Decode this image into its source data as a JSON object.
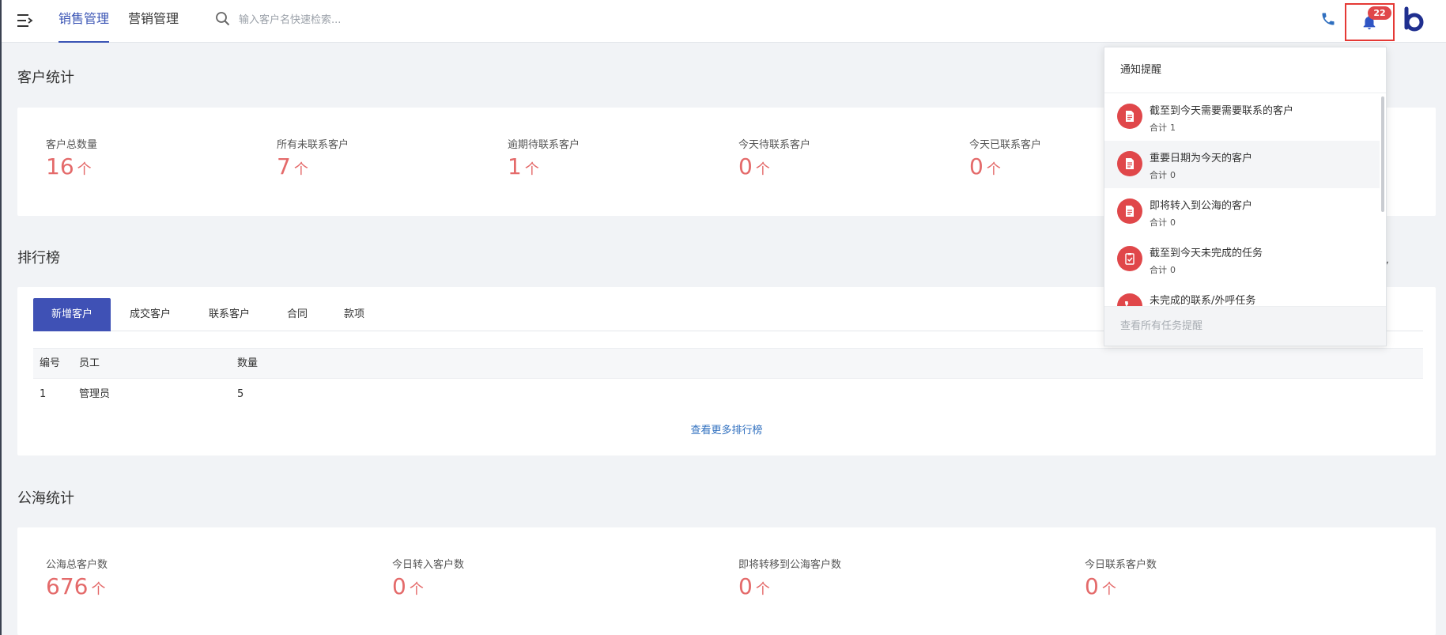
{
  "nav": {
    "tabs": [
      {
        "label": "销售管理",
        "active": true
      },
      {
        "label": "营销管理",
        "active": false
      }
    ],
    "search_placeholder": "输入客户名快速检索...",
    "notification_count": "22"
  },
  "customer_stats": {
    "title": "客户统计",
    "unit": "个",
    "items": [
      {
        "label": "客户总数量",
        "value": "16"
      },
      {
        "label": "所有未联系客户",
        "value": "7"
      },
      {
        "label": "逾期待联系客户",
        "value": "1"
      },
      {
        "label": "今天待联系客户",
        "value": "0"
      },
      {
        "label": "今天已联系客户",
        "value": "0"
      }
    ]
  },
  "ranking": {
    "title": "排行榜",
    "tabs": [
      "新增客户",
      "成交客户",
      "联系客户",
      "合同",
      "款项"
    ],
    "active_tab": 0,
    "columns": [
      "编号",
      "员工",
      "数量"
    ],
    "rows": [
      [
        "1",
        "管理员",
        "5"
      ]
    ],
    "more_link": "查看更多排行榜"
  },
  "sea_stats": {
    "title": "公海统计",
    "unit": "个",
    "items": [
      {
        "label": "公海总客户数",
        "value": "676"
      },
      {
        "label": "今日转入客户数",
        "value": "0"
      },
      {
        "label": "即将转移到公海客户数",
        "value": "0"
      },
      {
        "label": "今日联系客户数",
        "value": "0"
      }
    ]
  },
  "notifications": {
    "header": "通知提醒",
    "count_label": "合计",
    "items": [
      {
        "title": "截至到今天需要需要联系的客户",
        "count": "1",
        "icon": "document-icon"
      },
      {
        "title": "重要日期为今天的客户",
        "count": "0",
        "icon": "document-icon"
      },
      {
        "title": "即将转入到公海的客户",
        "count": "0",
        "icon": "document-icon"
      },
      {
        "title": "截至到今天未完成的任务",
        "count": "0",
        "icon": "clipboard-check-icon"
      },
      {
        "title": "未完成的联系/外呼任务",
        "count": "",
        "icon": "phone-icon"
      }
    ],
    "footer": "查看所有任务提醒"
  },
  "colors": {
    "accent": "#3f51b5",
    "stat_value": "#e46a6a",
    "badge": "#e0474a",
    "link": "#2f6fbf"
  }
}
